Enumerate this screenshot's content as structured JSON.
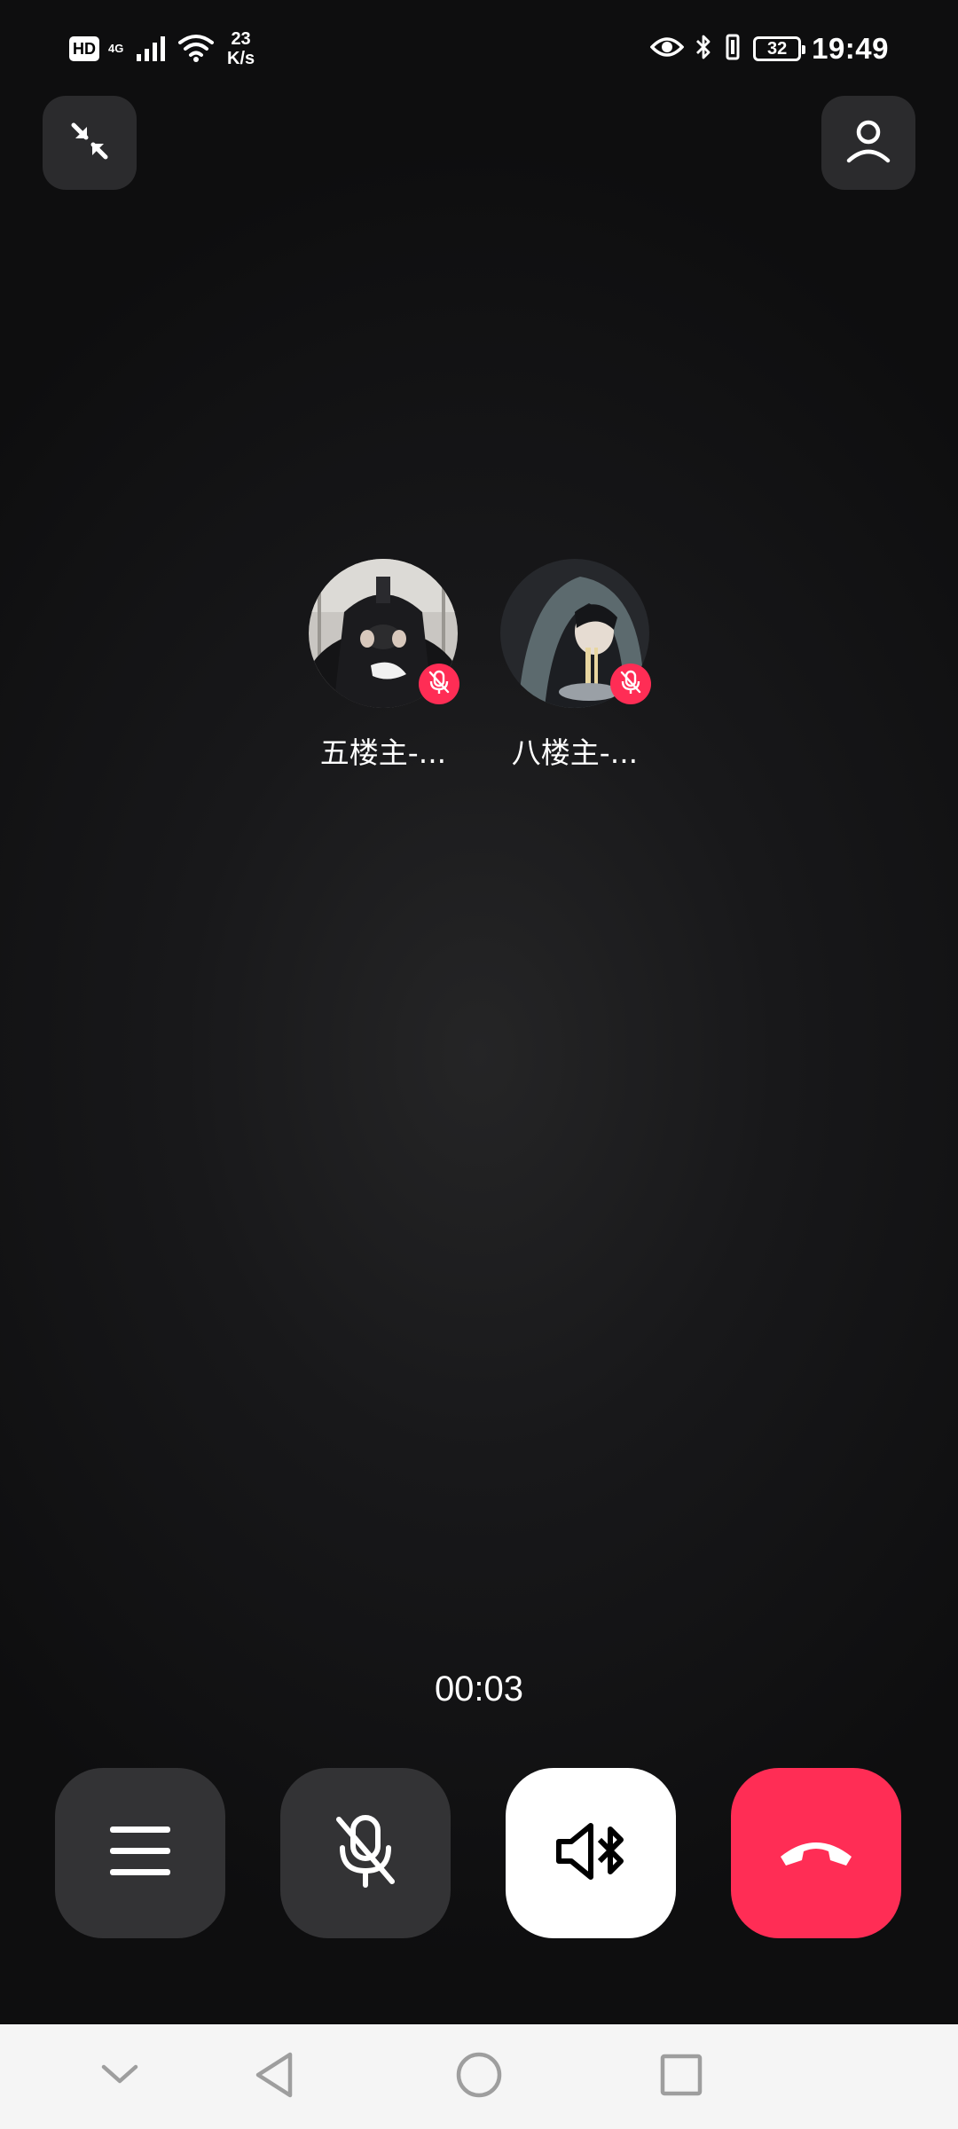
{
  "status_bar": {
    "hd_label": "HD",
    "network_type": "4G",
    "speed_value": "23",
    "speed_unit": "K/s",
    "battery_level": "32",
    "time": "19:49"
  },
  "participants": [
    {
      "name": "五楼主-...",
      "muted": true
    },
    {
      "name": "八楼主-...",
      "muted": true
    }
  ],
  "call": {
    "duration": "00:03"
  },
  "controls": [
    {
      "id": "menu",
      "icon": "menu-icon"
    },
    {
      "id": "mute",
      "icon": "mic-off-icon"
    },
    {
      "id": "speaker",
      "icon": "speaker-bluetooth-icon"
    },
    {
      "id": "hangup",
      "icon": "hang-up-icon"
    }
  ],
  "colors": {
    "hangup": "#ff2d55",
    "muted_badge": "#ff2d55",
    "button_dark": "#333335",
    "speaker_active": "#ffffff"
  }
}
